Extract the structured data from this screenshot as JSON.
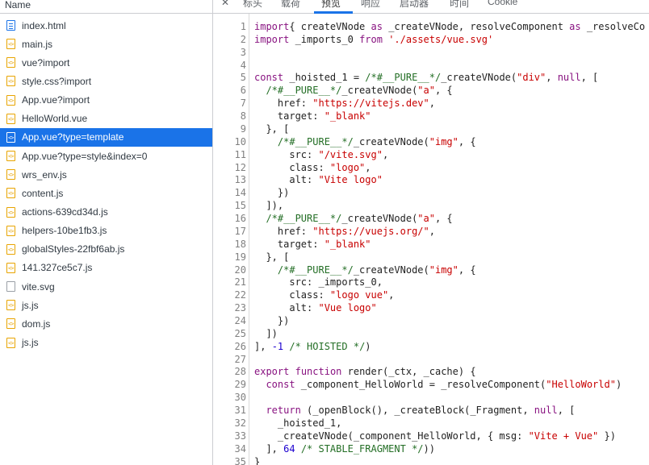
{
  "sidebar": {
    "header": "Name",
    "files": [
      {
        "name": "index.html",
        "icon": "document-icon"
      },
      {
        "name": "main.js",
        "icon": "script-icon"
      },
      {
        "name": "vue?import",
        "icon": "script-icon"
      },
      {
        "name": "style.css?import",
        "icon": "script-icon"
      },
      {
        "name": "App.vue?import",
        "icon": "script-icon"
      },
      {
        "name": "HelloWorld.vue",
        "icon": "script-icon"
      },
      {
        "name": "App.vue?type=template",
        "icon": "script-icon",
        "selected": true
      },
      {
        "name": "App.vue?type=style&index=0",
        "icon": "script-icon"
      },
      {
        "name": "wrs_env.js",
        "icon": "script-icon"
      },
      {
        "name": "content.js",
        "icon": "script-icon"
      },
      {
        "name": "actions-639cd34d.js",
        "icon": "script-icon"
      },
      {
        "name": "helpers-10be1fb3.js",
        "icon": "script-icon"
      },
      {
        "name": "globalStyles-22fbf6ab.js",
        "icon": "script-icon"
      },
      {
        "name": "141.327ce5c7.js",
        "icon": "script-icon"
      },
      {
        "name": "vite.svg",
        "icon": "file-icon"
      },
      {
        "name": "js.js",
        "icon": "script-icon"
      },
      {
        "name": "dom.js",
        "icon": "script-icon"
      },
      {
        "name": "js.js",
        "icon": "script-icon"
      }
    ]
  },
  "tabs": {
    "close": "✕",
    "items": [
      "标头",
      "载荷",
      "预览",
      "响应",
      "启动器",
      "时间",
      "Cookie"
    ],
    "active": "预览"
  },
  "colors": {
    "accent": "#1a73e8",
    "keyword": "#881280",
    "string": "#c80000",
    "comment": "#236e25",
    "number": "#1c00cf"
  },
  "code_lines": [
    {
      "n": "1",
      "parts": [
        [
          "kw",
          "import"
        ],
        [
          "",
          "{ createVNode "
        ],
        [
          "kw",
          "as"
        ],
        [
          "",
          " _createVNode, resolveComponent "
        ],
        [
          "kw",
          "as"
        ],
        [
          "",
          " _resolveCo"
        ]
      ]
    },
    {
      "n": "2",
      "parts": [
        [
          "kw",
          "import"
        ],
        [
          "",
          " _imports_0 "
        ],
        [
          "kw",
          "from"
        ],
        [
          "",
          " "
        ],
        [
          "str",
          "'./assets/vue.svg'"
        ]
      ]
    },
    {
      "n": "3",
      "parts": []
    },
    {
      "n": "4",
      "parts": []
    },
    {
      "n": "5",
      "parts": [
        [
          "kw",
          "const"
        ],
        [
          "",
          " _hoisted_1 = "
        ],
        [
          "com",
          "/*#__PURE__*/"
        ],
        [
          "",
          "_createVNode("
        ],
        [
          "str",
          "\"div\""
        ],
        [
          ", ",
          ""
        ],
        [
          "kw",
          "null"
        ],
        [
          "",
          ", ["
        ]
      ]
    },
    {
      "n": "6",
      "parts": [
        [
          "",
          "  "
        ],
        [
          "com",
          "/*#__PURE__*/"
        ],
        [
          "",
          "_createVNode("
        ],
        [
          "str",
          "\"a\""
        ],
        [
          "",
          ", {"
        ]
      ]
    },
    {
      "n": "7",
      "parts": [
        [
          "",
          "    href: "
        ],
        [
          "str",
          "\"https://vitejs.dev\""
        ],
        [
          "",
          ","
        ]
      ]
    },
    {
      "n": "8",
      "parts": [
        [
          "",
          "    target: "
        ],
        [
          "str",
          "\"_blank\""
        ]
      ]
    },
    {
      "n": "9",
      "parts": [
        [
          "",
          "  }, ["
        ]
      ]
    },
    {
      "n": "10",
      "parts": [
        [
          "",
          "    "
        ],
        [
          "com",
          "/*#__PURE__*/"
        ],
        [
          "",
          "_createVNode("
        ],
        [
          "str",
          "\"img\""
        ],
        [
          "",
          ", {"
        ]
      ]
    },
    {
      "n": "11",
      "parts": [
        [
          "",
          "      src: "
        ],
        [
          "str",
          "\"/vite.svg\""
        ],
        [
          "",
          ","
        ]
      ]
    },
    {
      "n": "12",
      "parts": [
        [
          "",
          "      class: "
        ],
        [
          "str",
          "\"logo\""
        ],
        [
          "",
          ","
        ]
      ]
    },
    {
      "n": "13",
      "parts": [
        [
          "",
          "      alt: "
        ],
        [
          "str",
          "\"Vite logo\""
        ]
      ]
    },
    {
      "n": "14",
      "parts": [
        [
          "",
          "    })"
        ]
      ]
    },
    {
      "n": "15",
      "parts": [
        [
          "",
          "  ]),"
        ]
      ]
    },
    {
      "n": "16",
      "parts": [
        [
          "",
          "  "
        ],
        [
          "com",
          "/*#__PURE__*/"
        ],
        [
          "",
          "_createVNode("
        ],
        [
          "str",
          "\"a\""
        ],
        [
          "",
          ", {"
        ]
      ]
    },
    {
      "n": "17",
      "parts": [
        [
          "",
          "    href: "
        ],
        [
          "str",
          "\"https://vuejs.org/\""
        ],
        [
          "",
          ","
        ]
      ]
    },
    {
      "n": "18",
      "parts": [
        [
          "",
          "    target: "
        ],
        [
          "str",
          "\"_blank\""
        ]
      ]
    },
    {
      "n": "19",
      "parts": [
        [
          "",
          "  }, ["
        ]
      ]
    },
    {
      "n": "20",
      "parts": [
        [
          "",
          "    "
        ],
        [
          "com",
          "/*#__PURE__*/"
        ],
        [
          "",
          "_createVNode("
        ],
        [
          "str",
          "\"img\""
        ],
        [
          "",
          ", {"
        ]
      ]
    },
    {
      "n": "21",
      "parts": [
        [
          "",
          "      src: _imports_0,"
        ]
      ]
    },
    {
      "n": "22",
      "parts": [
        [
          "",
          "      class: "
        ],
        [
          "str",
          "\"logo vue\""
        ],
        [
          "",
          ","
        ]
      ]
    },
    {
      "n": "23",
      "parts": [
        [
          "",
          "      alt: "
        ],
        [
          "str",
          "\"Vue logo\""
        ]
      ]
    },
    {
      "n": "24",
      "parts": [
        [
          "",
          "    })"
        ]
      ]
    },
    {
      "n": "25",
      "parts": [
        [
          "",
          "  ])"
        ]
      ]
    },
    {
      "n": "26",
      "parts": [
        [
          "",
          "], "
        ],
        [
          "num",
          "-1"
        ],
        [
          "",
          " "
        ],
        [
          "com",
          "/* HOISTED */"
        ],
        [
          "",
          ")"
        ]
      ]
    },
    {
      "n": "27",
      "parts": []
    },
    {
      "n": "28",
      "parts": [
        [
          "kw",
          "export"
        ],
        [
          "",
          " "
        ],
        [
          "kw",
          "function"
        ],
        [
          "",
          " render(_ctx, _cache) {"
        ]
      ]
    },
    {
      "n": "29",
      "parts": [
        [
          "",
          "  "
        ],
        [
          "kw",
          "const"
        ],
        [
          "",
          " _component_HelloWorld = _resolveComponent("
        ],
        [
          "str",
          "\"HelloWorld\""
        ],
        [
          "",
          ")"
        ]
      ]
    },
    {
      "n": "30",
      "parts": []
    },
    {
      "n": "31",
      "parts": [
        [
          "",
          "  "
        ],
        [
          "kw",
          "return"
        ],
        [
          "",
          " (_openBlock(), _createBlock(_Fragment, "
        ],
        [
          "kw",
          "null"
        ],
        [
          "",
          ", ["
        ]
      ]
    },
    {
      "n": "32",
      "parts": [
        [
          "",
          "    _hoisted_1,"
        ]
      ]
    },
    {
      "n": "33",
      "parts": [
        [
          "",
          "    _createVNode(_component_HelloWorld, { msg: "
        ],
        [
          "str",
          "\"Vite + Vue\""
        ],
        [
          "",
          " })"
        ]
      ]
    },
    {
      "n": "34",
      "parts": [
        [
          "",
          "  ], "
        ],
        [
          "num",
          "64"
        ],
        [
          "",
          " "
        ],
        [
          "com",
          "/* STABLE_FRAGMENT */"
        ],
        [
          "",
          "))"
        ]
      ]
    },
    {
      "n": "35",
      "parts": [
        [
          "",
          "}"
        ]
      ]
    }
  ]
}
